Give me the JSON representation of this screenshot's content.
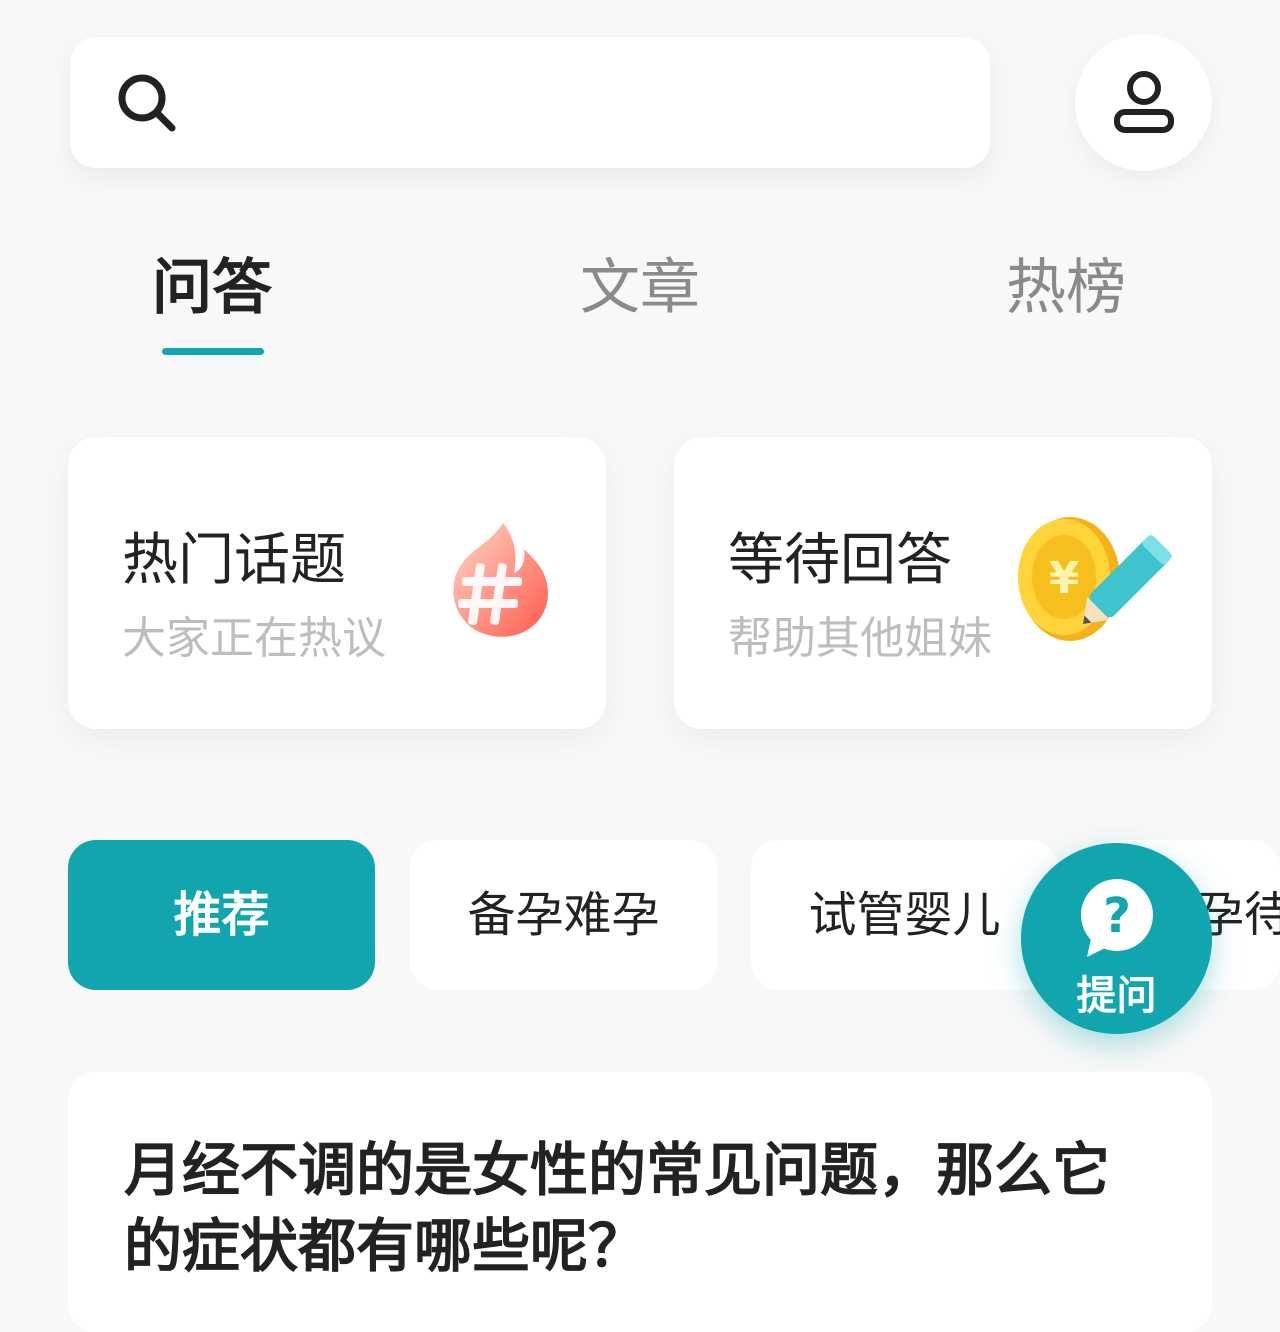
{
  "search": {
    "placeholder": "",
    "value": "",
    "icon": "search-icon"
  },
  "profile": {
    "icon": "user-icon"
  },
  "tabs": [
    {
      "label": "问答",
      "active": true
    },
    {
      "label": "文章",
      "active": false
    },
    {
      "label": "热榜",
      "active": false
    }
  ],
  "feature_cards": [
    {
      "title": "热门话题",
      "subtitle": "大家正在热议",
      "icon": "fire-hashtag-icon"
    },
    {
      "title": "等待回答",
      "subtitle": "帮助其他姐妹",
      "icon": "coin-pencil-icon"
    }
  ],
  "categories": [
    {
      "label": "推荐",
      "active": true
    },
    {
      "label": "备孕难孕",
      "active": false
    },
    {
      "label": "试管婴儿",
      "active": false
    },
    {
      "label": "孕待",
      "active": false
    }
  ],
  "fab": {
    "label": "提问",
    "icon": "question-bubble-icon"
  },
  "post": {
    "title": "月经不调的是女性的常见问题，那么它的症状都有哪些呢？"
  },
  "colors": {
    "accent": "#11a6ae",
    "background": "#f8f8f8",
    "card": "#ffffff"
  }
}
